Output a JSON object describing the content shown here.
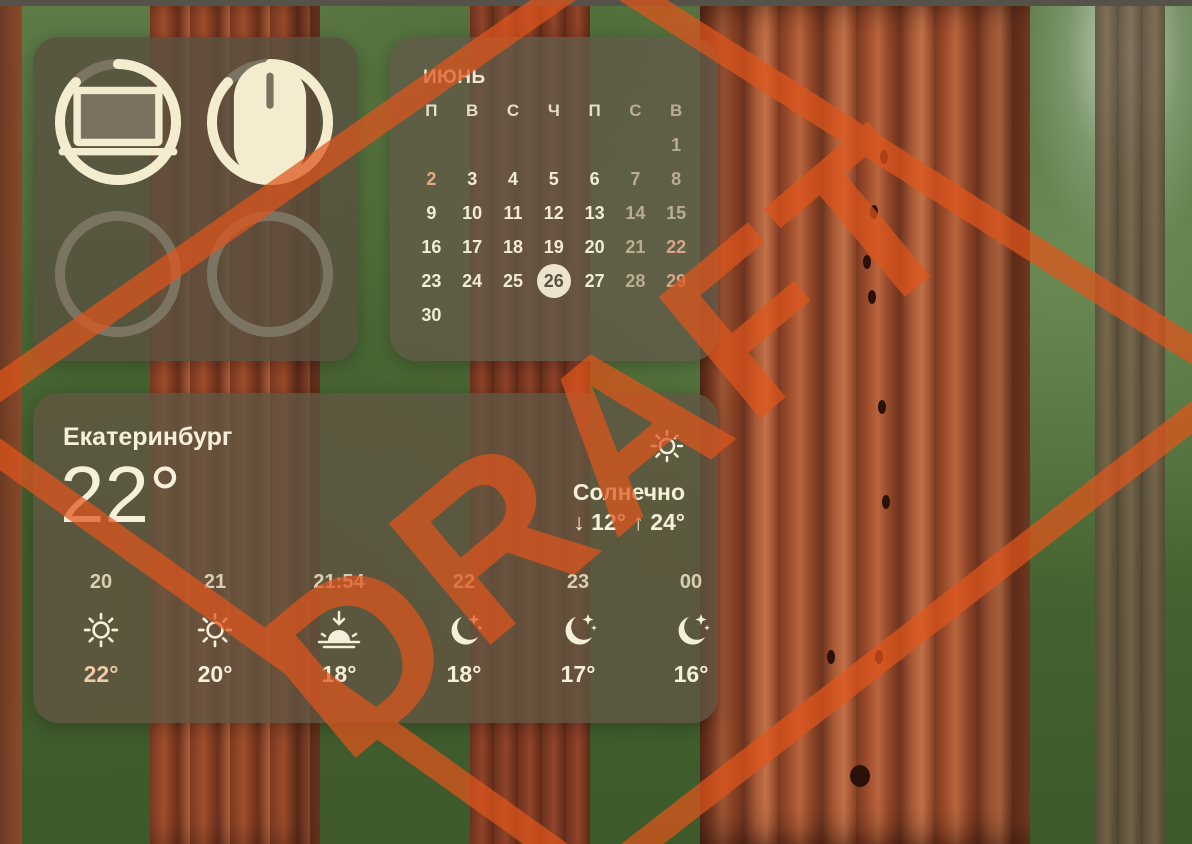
{
  "battery_widget": {
    "devices": [
      {
        "name": "laptop",
        "icon": "laptop-icon",
        "level": 0.87
      },
      {
        "name": "mouse",
        "icon": "mouse-icon",
        "level": 0.87
      },
      {
        "name": "empty-slot",
        "icon": "",
        "level": 0
      },
      {
        "name": "empty-slot",
        "icon": "",
        "level": 0
      }
    ]
  },
  "calendar": {
    "month": "ИЮНЬ",
    "weekdays": [
      "П",
      "В",
      "С",
      "Ч",
      "П",
      "С",
      "В"
    ],
    "first_weekday_index": 6,
    "days_in_month": 30,
    "today": 26,
    "labels": {
      "d1": "1",
      "d2": "2",
      "d3": "3",
      "d4": "4",
      "d5": "5",
      "d6": "6",
      "d7": "7",
      "d8": "8",
      "d9": "9",
      "d10": "10",
      "d11": "11",
      "d12": "12",
      "d13": "13",
      "d14": "14",
      "d15": "15",
      "d16": "16",
      "d17": "17",
      "d18": "18",
      "d19": "19",
      "d20": "20",
      "d21": "21",
      "d22": "22",
      "d23": "23",
      "d24": "24",
      "d25": "25",
      "d26": "26",
      "d27": "27",
      "d28": "28",
      "d29": "29",
      "d30": "30"
    }
  },
  "weather": {
    "city": "Екатеринбург",
    "temperature": "22°",
    "condition": "Солнечно",
    "condition_icon": "sun-icon",
    "range": "↓ 12° ↑ 24°",
    "hourly": [
      {
        "time": "20",
        "icon": "sun-icon",
        "temp": "22°"
      },
      {
        "time": "21",
        "icon": "sun-icon",
        "temp": "20°"
      },
      {
        "time": "21:54",
        "icon": "sunset-icon",
        "temp": "18°"
      },
      {
        "time": "22",
        "icon": "moon-stars-icon",
        "temp": "18°"
      },
      {
        "time": "23",
        "icon": "moon-stars-icon",
        "temp": "17°"
      },
      {
        "time": "00",
        "icon": "moon-stars-icon",
        "temp": "16°"
      }
    ]
  },
  "watermark": {
    "text": "DRAFT",
    "color": "#e0551c"
  },
  "colors": {
    "widget_text": "#f4efdd",
    "ring_active": "#f3eccf",
    "ring_inactive": "#7c7462",
    "today_highlight": "#ece4cf"
  }
}
